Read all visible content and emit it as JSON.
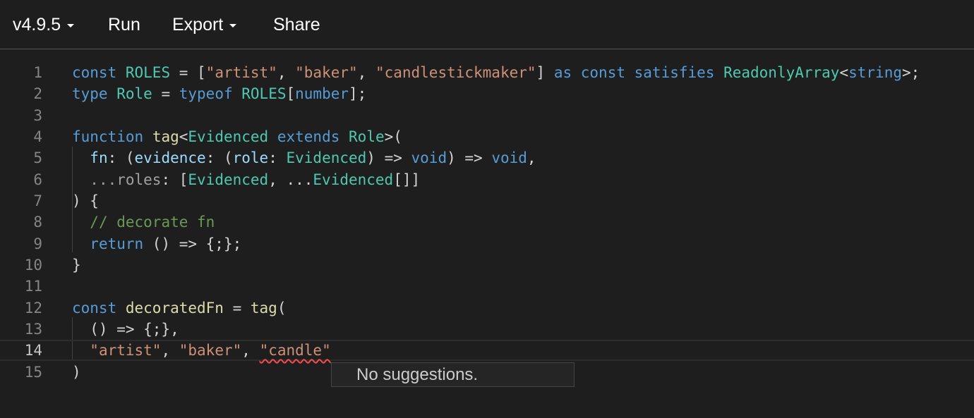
{
  "toolbar": {
    "version": "v4.9.5",
    "run": "Run",
    "export": "Export",
    "share": "Share"
  },
  "editor": {
    "line_numbers": [
      "1",
      "2",
      "3",
      "4",
      "5",
      "6",
      "7",
      "8",
      "9",
      "10",
      "11",
      "12",
      "13",
      "14",
      "15"
    ],
    "current_line": "14",
    "lines": [
      "const ROLES = [\"artist\", \"baker\", \"candlestickmaker\"] as const satisfies ReadonlyArray<string>;",
      "type Role = typeof ROLES[number];",
      "",
      "function tag<Evidenced extends Role>(",
      "  fn: (evidence: (role: Evidenced) => void) => void,",
      "  ...roles: [Evidenced, ...Evidenced[]]",
      ") {",
      "  // decorate fn",
      "  return () => {;};",
      "}",
      "",
      "const decoratedFn = tag(",
      "  () => {;},",
      "  \"artist\", \"baker\", \"candle\"",
      ")"
    ]
  },
  "suggest_widget": {
    "message": "No suggestions."
  },
  "colors": {
    "background": "#1e1e1e",
    "keyword": "#569cd6",
    "type": "#4ec9b0",
    "string": "#ce9178",
    "comment": "#6a9955",
    "error": "#f14c4c"
  }
}
